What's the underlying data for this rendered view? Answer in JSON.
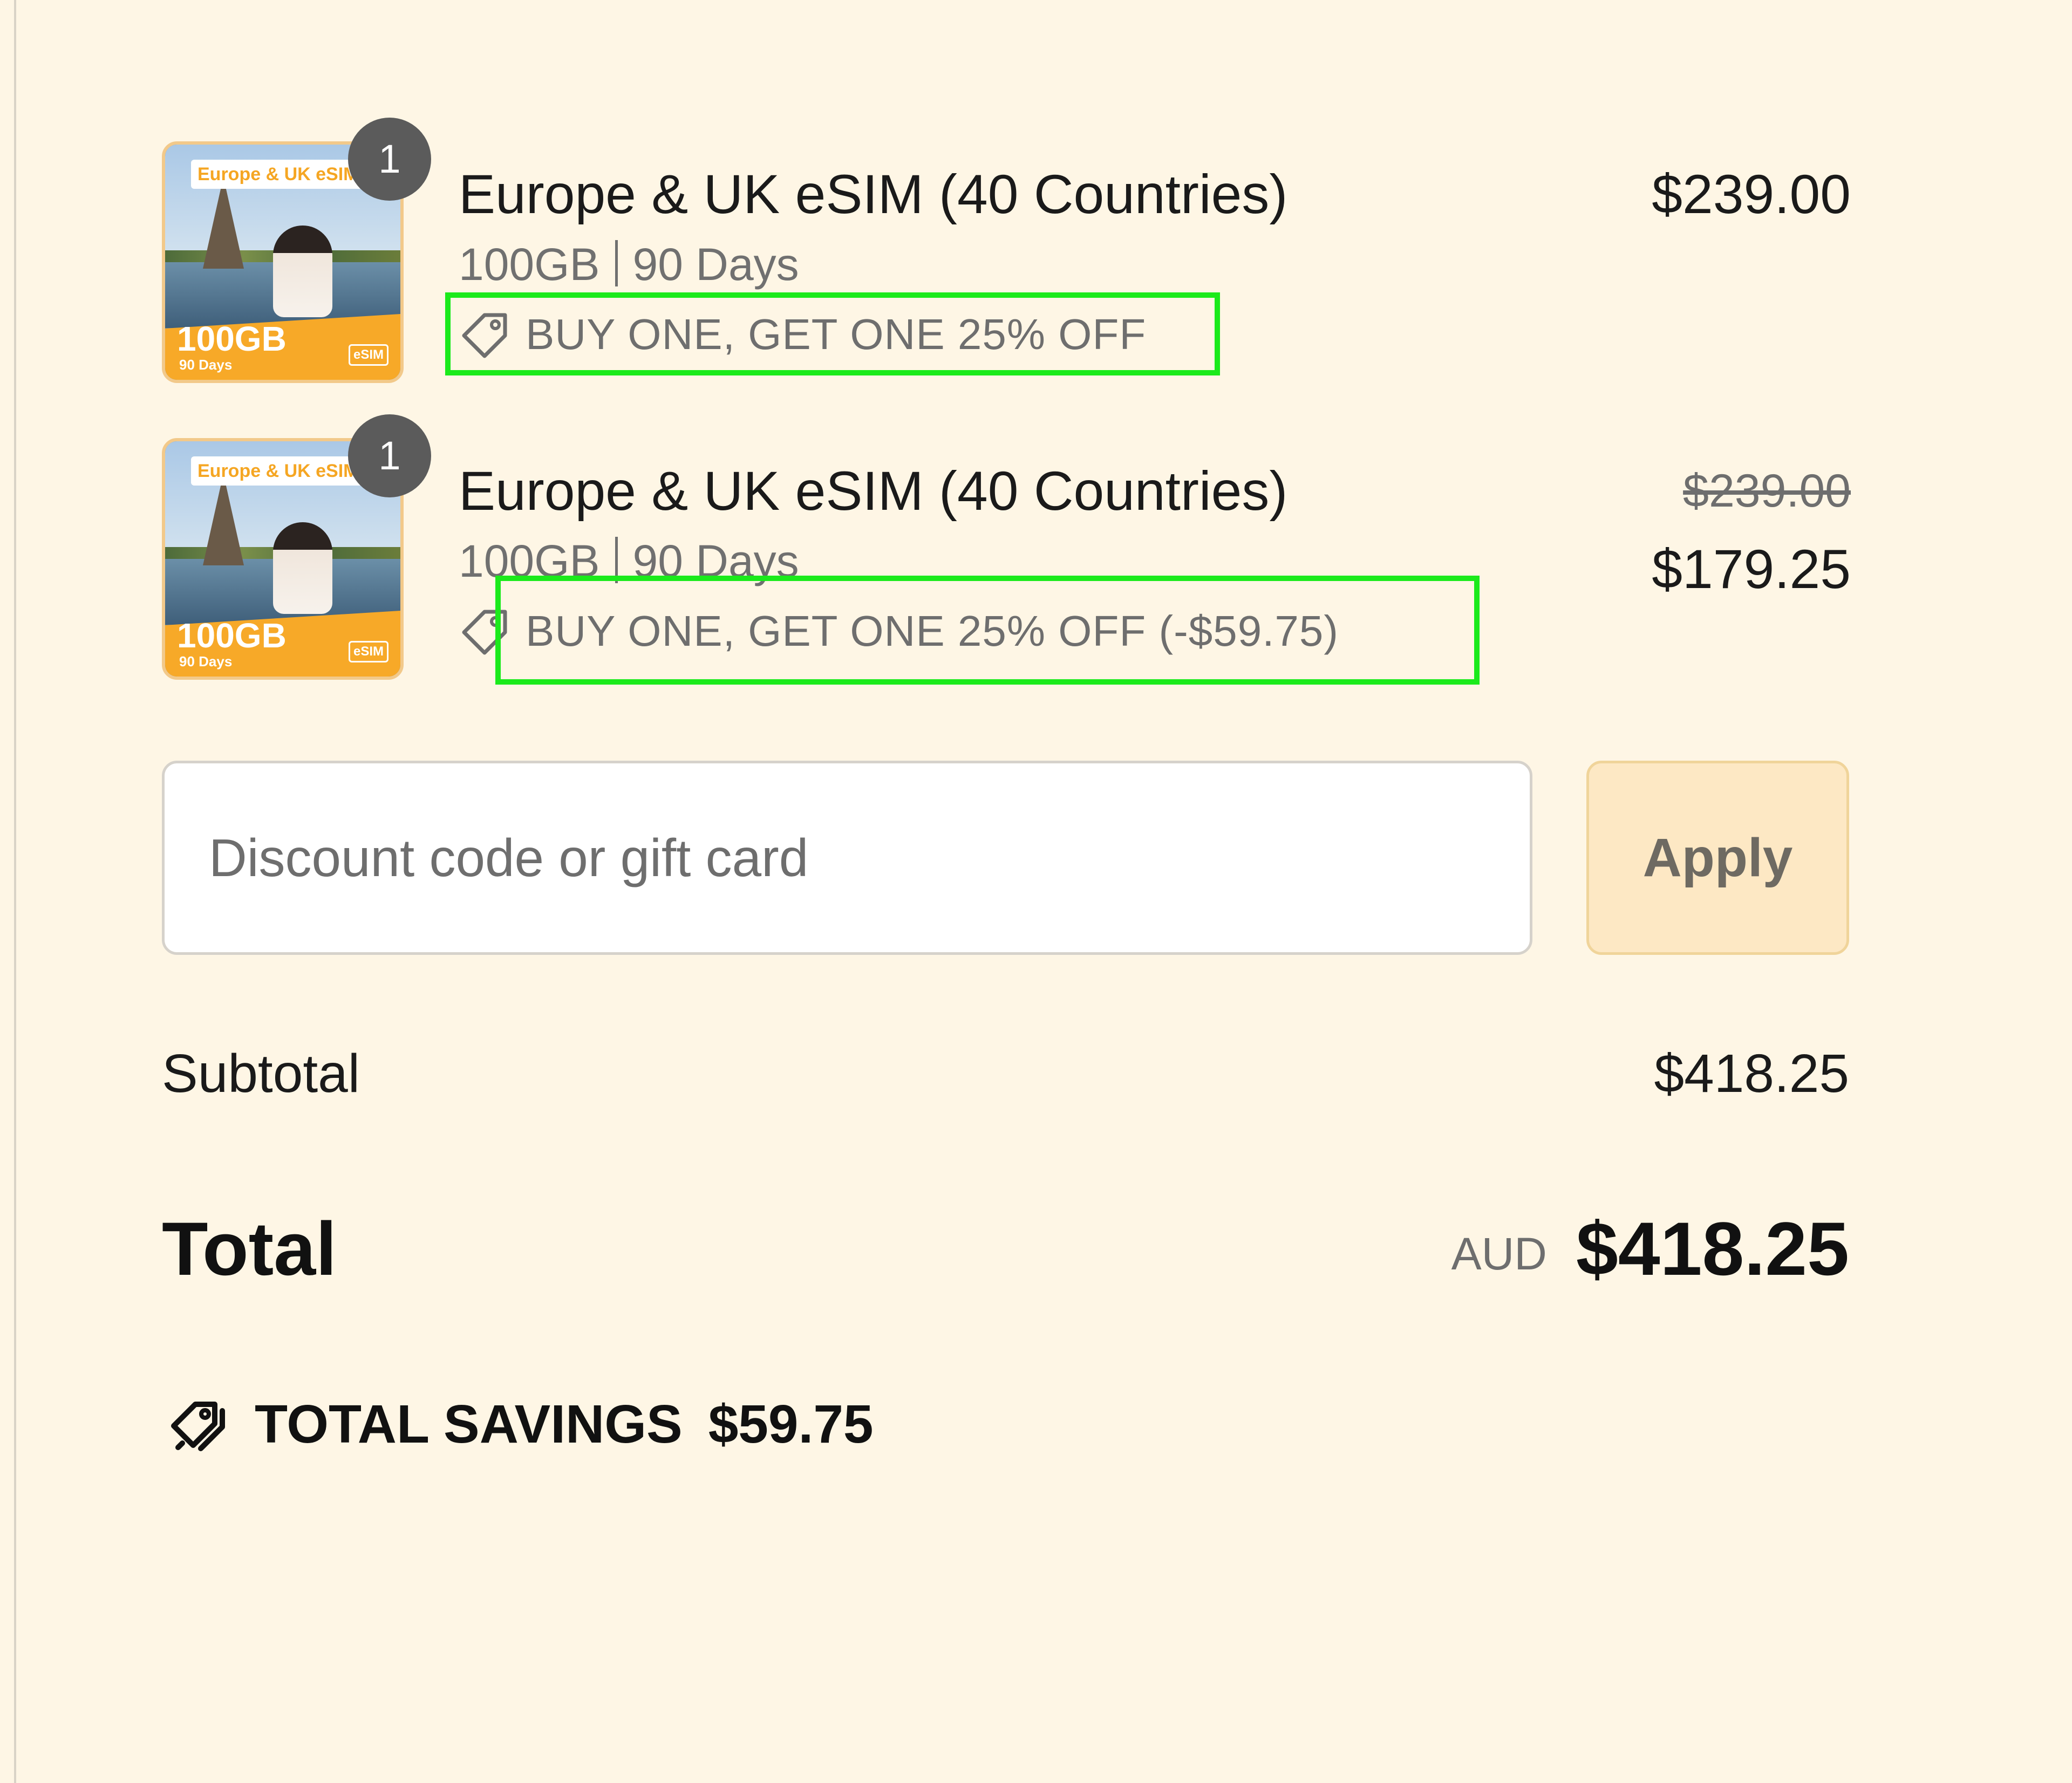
{
  "items": [
    {
      "thumbnail": {
        "top_label": "Europe & UK eSIM",
        "data": "100GB",
        "days": "90 Days",
        "badge": "eSIM"
      },
      "quantity": "1",
      "title": "Europe & UK eSIM (40 Countries)",
      "data": "100GB",
      "duration": "90 Days",
      "discount_text": "BUY ONE, GET ONE 25% OFF",
      "price": "$239.00"
    },
    {
      "thumbnail": {
        "top_label": "Europe & UK eSIM",
        "data": "100GB",
        "days": "90 Days",
        "badge": "eSIM"
      },
      "quantity": "1",
      "title": "Europe & UK eSIM (40 Countries)",
      "data": "100GB",
      "duration": "90 Days",
      "discount_text": "BUY ONE, GET ONE 25% OFF (-$59.75)",
      "original_price": "$239.00",
      "price": "$179.25"
    }
  ],
  "discount_form": {
    "placeholder": "Discount code or gift card",
    "value": "",
    "apply_label": "Apply"
  },
  "summary": {
    "subtotal_label": "Subtotal",
    "subtotal_value": "$418.25",
    "total_label": "Total",
    "currency": "AUD",
    "total_value": "$418.25",
    "savings_label": "TOTAL SAVINGS",
    "savings_value": "$59.75"
  },
  "colors": {
    "background": "#fef6e5",
    "highlight": "#1bea1b",
    "apply_button": "#fde8c4",
    "thumbnail_accent": "#f7a928"
  },
  "icons": {
    "discount_tag": "tag-icon",
    "savings": "tags-icon"
  }
}
